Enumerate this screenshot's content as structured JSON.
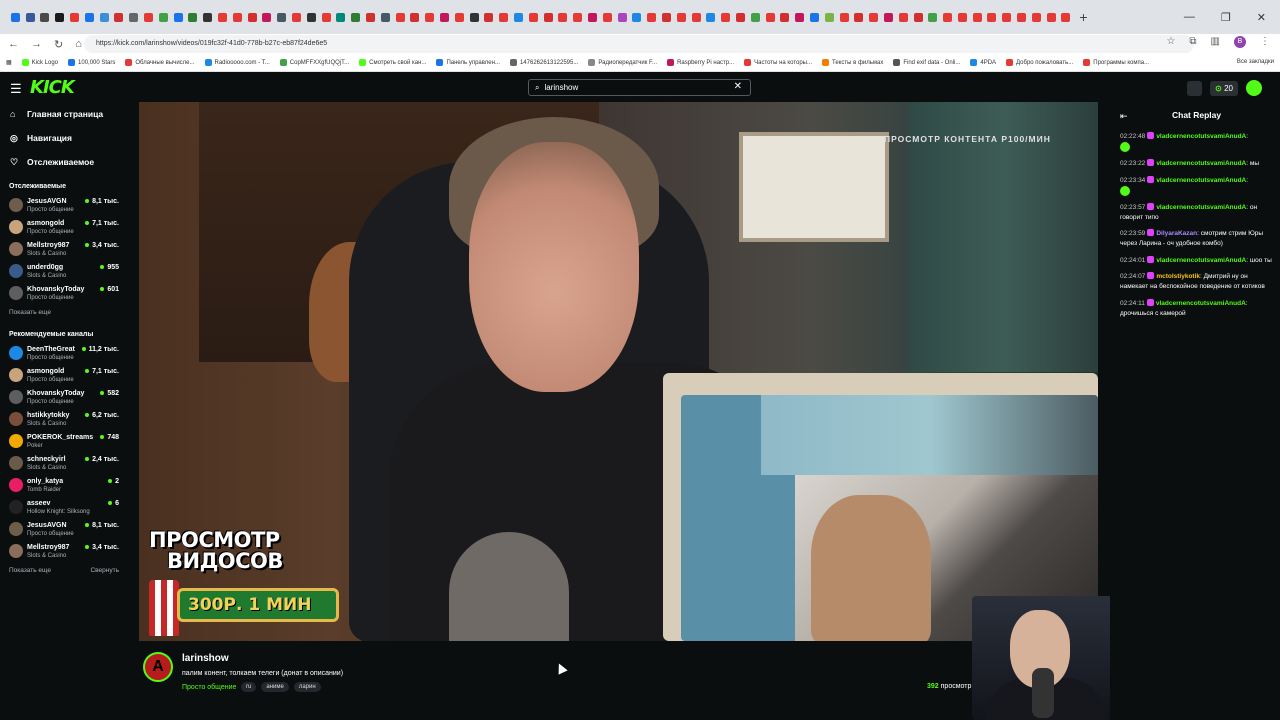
{
  "browser": {
    "url": "https://kick.com/larinshow/videos/019fc32f-41d0-778b-b27c-eb87f24de6e5",
    "bookmarks": [
      "Kick Logo",
      "100,000 Stars",
      "Облачные вычисле...",
      "Radiooooo.com - T...",
      "CopMFFXXgfUQQjT...",
      "Смотреть свой кан...",
      "Панель управлен...",
      "1476262613122595...",
      "Радиопередатчик F...",
      "Raspberry Pi настр...",
      "Частоты на которы...",
      "Тексты в фильмах",
      "Find exif data - Onli...",
      "4PDA",
      "Добро пожаловать...",
      "Программы компа..."
    ],
    "all_bookmarks": "Все закладки",
    "profile_initial": "B",
    "tab_colors": [
      "#1a73e8",
      "#3b5998",
      "#4a4a4a",
      "#1b1b1b",
      "#e53935",
      "#1a73e8",
      "#3b8fd8",
      "#d32f2f",
      "#666",
      "#e53935",
      "#43a047",
      "#1a73e8",
      "#2e7d32",
      "#333",
      "#e53935",
      "#e53935",
      "#d32f2f",
      "#c2185b",
      "#455a64",
      "#e53935",
      "#333",
      "#e53935",
      "#00897b",
      "#2e7d32",
      "#d32f2f",
      "#455a64",
      "#e53935",
      "#d32f2f",
      "#e53935",
      "#c2185b",
      "#e53935",
      "#333",
      "#d32f2f",
      "#e53935",
      "#1e88e5",
      "#e53935",
      "#d32f2f",
      "#e53935",
      "#e53935",
      "#c2185b",
      "#e53935",
      "#ab47bc",
      "#1e88e5",
      "#e53935",
      "#d32f2f",
      "#e53935",
      "#e53935",
      "#1e88e5",
      "#e53935",
      "#d32f2f",
      "#43a047",
      "#e53935",
      "#d32f2f",
      "#c2185b",
      "#1a73e8",
      "#7cb342",
      "#e53935",
      "#d32f2f",
      "#e53935",
      "#c2185b",
      "#e53935",
      "#d32f2f",
      "#43a047",
      "#e53935",
      "#e53935",
      "#e53935",
      "#e53935",
      "#e53935",
      "#e53935",
      "#e53935",
      "#e53935",
      "#e53935"
    ]
  },
  "header": {
    "logo": "KICK",
    "search_value": "larinshow",
    "points": "20"
  },
  "sidebar": {
    "nav": [
      {
        "icon": "home-icon",
        "glyph": "⌂",
        "label": "Главная страница"
      },
      {
        "icon": "compass-icon",
        "glyph": "◎",
        "label": "Навигация"
      },
      {
        "icon": "heart-icon",
        "glyph": "♡",
        "label": "Отслеживаемое"
      }
    ],
    "followed_title": "Отслеживаемые",
    "followed": [
      {
        "name": "JesusAVGN",
        "category": "Просто общение",
        "viewers": "8,1 тыс.",
        "color": "#6d5d4b"
      },
      {
        "name": "asmongold",
        "category": "Просто общение",
        "viewers": "7,1 тыс.",
        "color": "#c7a47c"
      },
      {
        "name": "Mellstroy987",
        "category": "Slots & Casino",
        "viewers": "3,4 тыс.",
        "color": "#8a6d5a"
      },
      {
        "name": "underd0gg",
        "category": "Slots & Casino",
        "viewers": "955",
        "color": "#3a5a8a"
      },
      {
        "name": "KhovanskyToday",
        "category": "Просто общение",
        "viewers": "601",
        "color": "#5e5e5e"
      }
    ],
    "show_more_1": "Показать еще",
    "recommended_title": "Рекомендуемые каналы",
    "recommended": [
      {
        "name": "DeenTheGreat",
        "category": "Просто общение",
        "viewers": "11,2 тыс.",
        "color": "#1e88e5"
      },
      {
        "name": "asmongold",
        "category": "Просто общение",
        "viewers": "7,1 тыс.",
        "color": "#c7a47c"
      },
      {
        "name": "KhovanskyToday",
        "category": "Просто общение",
        "viewers": "582",
        "color": "#5e5e5e"
      },
      {
        "name": "hstikkytokky",
        "category": "Slots & Casino",
        "viewers": "6,2 тыс.",
        "color": "#7a4e3a"
      },
      {
        "name": "POKEROK_streams",
        "category": "Poker",
        "viewers": "748",
        "color": "#f2a900"
      },
      {
        "name": "schneckyirl",
        "category": "Slots & Casino",
        "viewers": "2,4 тыс.",
        "color": "#6a5a4a"
      },
      {
        "name": "only_katya",
        "category": "Tomb Raider",
        "viewers": "2",
        "color": "#e91e63"
      },
      {
        "name": "asseev",
        "category": "Hollow Knight: Silksong",
        "viewers": "6",
        "color": "#222"
      },
      {
        "name": "JesusAVGN",
        "category": "Просто общение",
        "viewers": "8,1 тыс.",
        "color": "#6d5d4b"
      },
      {
        "name": "Mellstroy987",
        "category": "Slots & Casino",
        "viewers": "3,4 тыс.",
        "color": "#8a6d5a"
      }
    ],
    "show_more_2": "Показать еще",
    "collapse": "Свернуть"
  },
  "video": {
    "overlay_text": "ПРОСМОТР КОНТЕНТА Р100/МИН",
    "promo_line1": "ПРОСМОТР",
    "promo_line2": "ВИДОСОВ",
    "promo_price": "300Р. 1 МИН"
  },
  "stream": {
    "avatar_letter": "A",
    "name": "larinshow",
    "title": "палим конент, толкаем телеги (донат в описании)",
    "category": "Просто общение",
    "tags": [
      "ru",
      "аниме",
      "ларин"
    ],
    "viewers_count": "392",
    "viewers_label": "просмотр"
  },
  "chat": {
    "title": "Chat Replay",
    "messages": [
      {
        "time": "02:22:48",
        "user": "vladcernencotutsvamiAnudA",
        "color": "#53fc18",
        "text": "",
        "emote": true
      },
      {
        "time": "02:23:22",
        "user": "vladcernencotutsvamiAnudA",
        "color": "#53fc18",
        "text": "мы",
        "emote": false
      },
      {
        "time": "02:23:34",
        "user": "vladcernencotutsvamiAnudA",
        "color": "#53fc18",
        "text": "",
        "emote": true
      },
      {
        "time": "02:23:57",
        "user": "vladcernencotutsvamiAnudA",
        "color": "#53fc18",
        "text": "он говорит типо",
        "emote": false
      },
      {
        "time": "02:23:59",
        "user": "DilyaraKazan",
        "color": "#a78bfa",
        "text": "смотрим стрим Юры через Ларина - оч удобное комбо)",
        "emote": false
      },
      {
        "time": "02:24:01",
        "user": "vladcernencotutsvamiAnudA",
        "color": "#53fc18",
        "text": "шоо ты",
        "emote": false
      },
      {
        "time": "02:24:07",
        "user": "mctolstiykotik",
        "color": "#f5c518",
        "text": "Дмитрий ну он намекает на беспокойное поведение от котиков",
        "emote": false
      },
      {
        "time": "02:24:11",
        "user": "vladcernencotutsvamiAnudA",
        "color": "#53fc18",
        "text": "дрочишься с камерой",
        "emote": false
      }
    ]
  }
}
